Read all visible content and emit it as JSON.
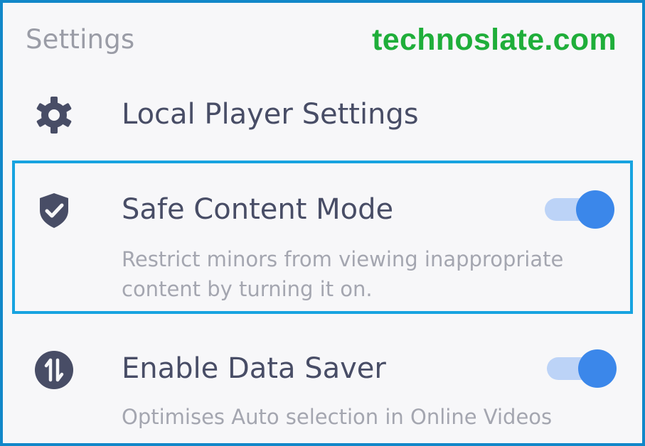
{
  "settings": {
    "section_title": "Settings",
    "watermark": "technoslate.com",
    "items": [
      {
        "title": "Local Player Settings",
        "icon": "gear-icon"
      },
      {
        "title": "Safe Content Mode",
        "description_line1": "Restrict minors from viewing inappropriate",
        "description_line2": "content by turning it on.",
        "icon": "shield-check-icon",
        "toggle_on": true
      },
      {
        "title": "Enable Data Saver",
        "description_line1": "Optimises Auto selection in Online Videos",
        "icon": "data-transfer-icon",
        "toggle_on": true
      }
    ]
  },
  "colors": {
    "frame_border": "#1187c9",
    "highlight_border": "#17a3e0",
    "watermark": "#1fae3a",
    "icon": "#484d66",
    "toggle_knob": "#3b87ea",
    "toggle_track": "#bcd3f7"
  }
}
